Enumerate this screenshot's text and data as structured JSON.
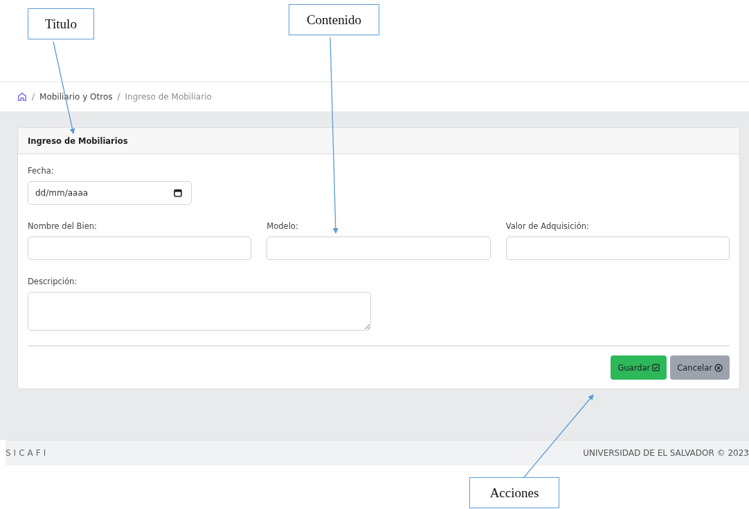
{
  "breadcrumb": {
    "items": [
      {
        "separator": "/",
        "label": "Mobiliario y Otros",
        "current": false
      },
      {
        "separator": "/",
        "label": "Ingreso de Mobiliario",
        "current": true
      }
    ]
  },
  "card": {
    "title": "Ingreso de Mobiliarios",
    "fields": [
      {
        "kind": "date",
        "label": "Fecha:",
        "placeholder": "dd/mm/aaaa"
      },
      {
        "kind": "text",
        "label": "Nombre del Bien:"
      },
      {
        "kind": "text",
        "label": "Modelo:"
      },
      {
        "kind": "text",
        "label": "Valor de Adquisición:"
      },
      {
        "kind": "textarea",
        "label": "Descripción:"
      }
    ],
    "buttons": [
      {
        "kind": "primary",
        "label": "Guardar"
      },
      {
        "kind": "secondary",
        "label": "Cancelar"
      }
    ]
  },
  "footer": {
    "brand": "SICAFI",
    "copyright": "UNIVERSIDAD DE EL SALVADOR © 2023"
  },
  "callouts": [
    {
      "label": "Titulo"
    },
    {
      "label": "Contenido"
    },
    {
      "label": "Acciones"
    }
  ]
}
